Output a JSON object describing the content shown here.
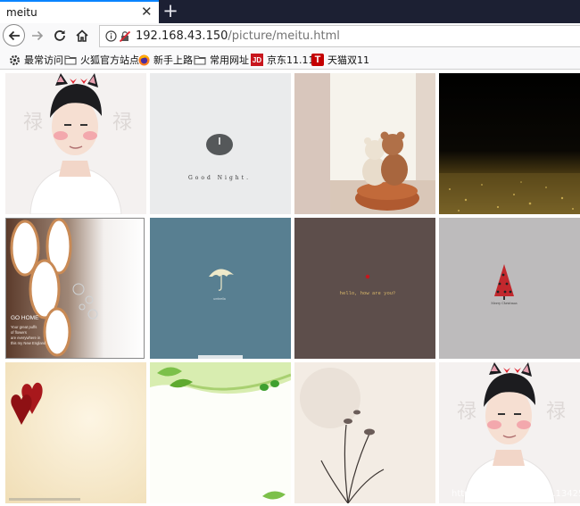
{
  "tab": {
    "title": "meitu",
    "close_glyph": "✕",
    "new_tab_glyph": "+"
  },
  "address_bar": {
    "host": "192.168.43.150",
    "path": "/picture/meitu.html"
  },
  "bookmarks": [
    {
      "label": "最常访问",
      "icon": "gear-icon"
    },
    {
      "label": "火狐官方站点",
      "icon": "folder-icon"
    },
    {
      "label": "新手上路",
      "icon": "firefox-icon"
    },
    {
      "label": "常用网址",
      "icon": "folder-icon"
    },
    {
      "label": "京东11.11",
      "icon": "jd-icon",
      "icon_text": "JD",
      "color": "#c8161d"
    },
    {
      "label": "天猫双11",
      "icon": "tmall-icon",
      "icon_text": "T",
      "color": "#c40000"
    }
  ],
  "gallery": {
    "images": [
      {
        "name": "portrait-man-cat-ears"
      },
      {
        "name": "good-night-clock",
        "caption": "Good Night."
      },
      {
        "name": "teddy-bears-window"
      },
      {
        "name": "gold-glitter-dark"
      },
      {
        "name": "bubbles-go-home",
        "caption_title": "GO HOME",
        "caption_lines": [
          "Your great puffs",
          "of flowers",
          "are everywhere in",
          "this my New England"
        ]
      },
      {
        "name": "umbrella-blue",
        "caption": "umbrella"
      },
      {
        "name": "hello-how-are-you",
        "caption": "hello, how are you?"
      },
      {
        "name": "ladybug-tree",
        "caption": "Merry Christmas"
      },
      {
        "name": "red-hearts-cream"
      },
      {
        "name": "green-leaves-white"
      },
      {
        "name": "ink-orchid"
      },
      {
        "name": "portrait-man-cat-ears-2"
      }
    ]
  },
  "watermark": "https://blog.csdn.net/...13425"
}
